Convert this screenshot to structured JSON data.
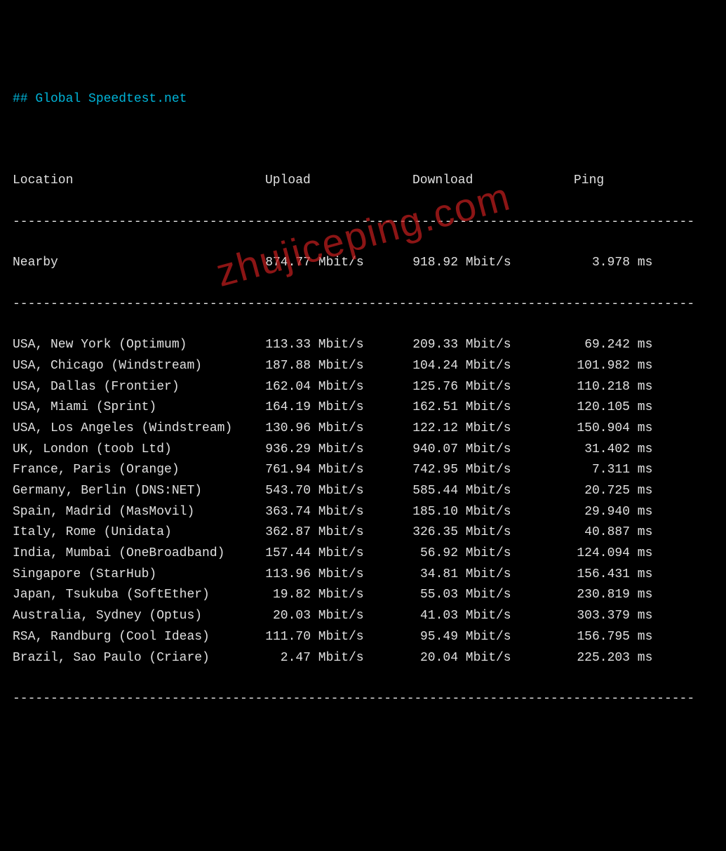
{
  "title": "## Global Speedtest.net",
  "watermark": "zhujiceping.com",
  "headers": {
    "location": "Location",
    "upload": "Upload",
    "download": "Download",
    "ping": "Ping"
  },
  "units": {
    "speed": "Mbit/s",
    "ping": "ms"
  },
  "nearby": {
    "location": "Nearby",
    "upload": "874.77",
    "download": "918.92",
    "ping": "3.978"
  },
  "rows": [
    {
      "location": "USA, New York (Optimum)",
      "upload": "113.33",
      "download": "209.33",
      "ping": "69.242"
    },
    {
      "location": "USA, Chicago (Windstream)",
      "upload": "187.88",
      "download": "104.24",
      "ping": "101.982"
    },
    {
      "location": "USA, Dallas (Frontier)",
      "upload": "162.04",
      "download": "125.76",
      "ping": "110.218"
    },
    {
      "location": "USA, Miami (Sprint)",
      "upload": "164.19",
      "download": "162.51",
      "ping": "120.105"
    },
    {
      "location": "USA, Los Angeles (Windstream)",
      "upload": "130.96",
      "download": "122.12",
      "ping": "150.904"
    },
    {
      "location": "UK, London (toob Ltd)",
      "upload": "936.29",
      "download": "940.07",
      "ping": "31.402"
    },
    {
      "location": "France, Paris (Orange)",
      "upload": "761.94",
      "download": "742.95",
      "ping": "7.311"
    },
    {
      "location": "Germany, Berlin (DNS:NET)",
      "upload": "543.70",
      "download": "585.44",
      "ping": "20.725"
    },
    {
      "location": "Spain, Madrid (MasMovil)",
      "upload": "363.74",
      "download": "185.10",
      "ping": "29.940"
    },
    {
      "location": "Italy, Rome (Unidata)",
      "upload": "362.87",
      "download": "326.35",
      "ping": "40.887"
    },
    {
      "location": "India, Mumbai (OneBroadband)",
      "upload": "157.44",
      "download": "56.92",
      "ping": "124.094"
    },
    {
      "location": "Singapore (StarHub)",
      "upload": "113.96",
      "download": "34.81",
      "ping": "156.431"
    },
    {
      "location": "Japan, Tsukuba (SoftEther)",
      "upload": "19.82",
      "download": "55.03",
      "ping": "230.819"
    },
    {
      "location": "Australia, Sydney (Optus)",
      "upload": "20.03",
      "download": "41.03",
      "ping": "303.379"
    },
    {
      "location": "RSA, Randburg (Cool Ideas)",
      "upload": "111.70",
      "download": "95.49",
      "ping": "156.795"
    },
    {
      "location": "Brazil, Sao Paulo (Criare)",
      "upload": "2.47",
      "download": "20.04",
      "ping": "225.203"
    }
  ]
}
